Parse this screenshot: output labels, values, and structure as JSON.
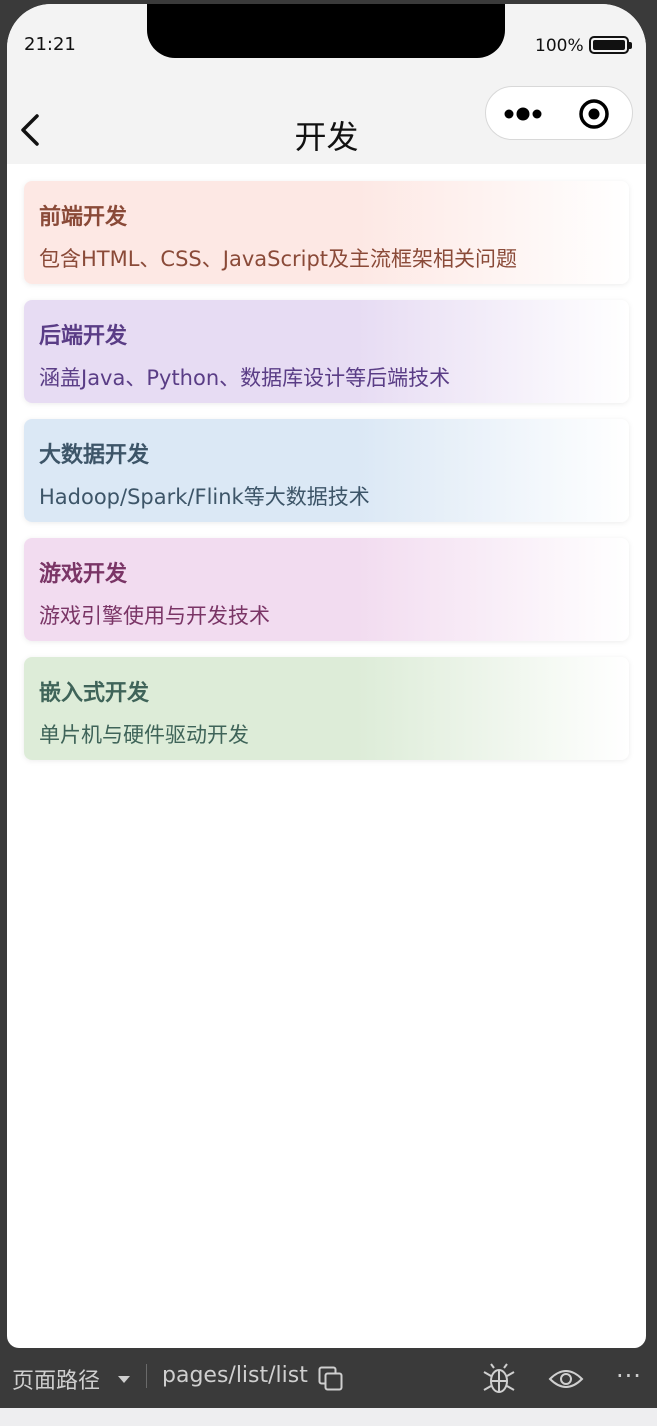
{
  "status_bar": {
    "time": "21:21",
    "battery_percent": "100%"
  },
  "nav": {
    "title": "开发"
  },
  "cards": [
    {
      "title": "前端开发",
      "desc": "包含HTML、CSS、JavaScript及主流框架相关问题",
      "bg": "#fde8e4",
      "text": "#8a4a38"
    },
    {
      "title": "后端开发",
      "desc": "涵盖Java、Python、数据库设计等后端技术",
      "bg": "#e7dcf3",
      "text": "#5a3d86"
    },
    {
      "title": "大数据开发",
      "desc": "Hadoop/Spark/Flink等大数据技术",
      "bg": "#dbe8f5",
      "text": "#3d5568"
    },
    {
      "title": "游戏开发",
      "desc": "游戏引擎使用与开发技术",
      "bg": "#f2dcf0",
      "text": "#7a3566"
    },
    {
      "title": "嵌入式开发",
      "desc": "单片机与硬件驱动开发",
      "bg": "#ddecd8",
      "text": "#3f6459"
    }
  ],
  "devtools": {
    "path_label": "页面路径",
    "path": "pages/list/list",
    "more": "···"
  }
}
